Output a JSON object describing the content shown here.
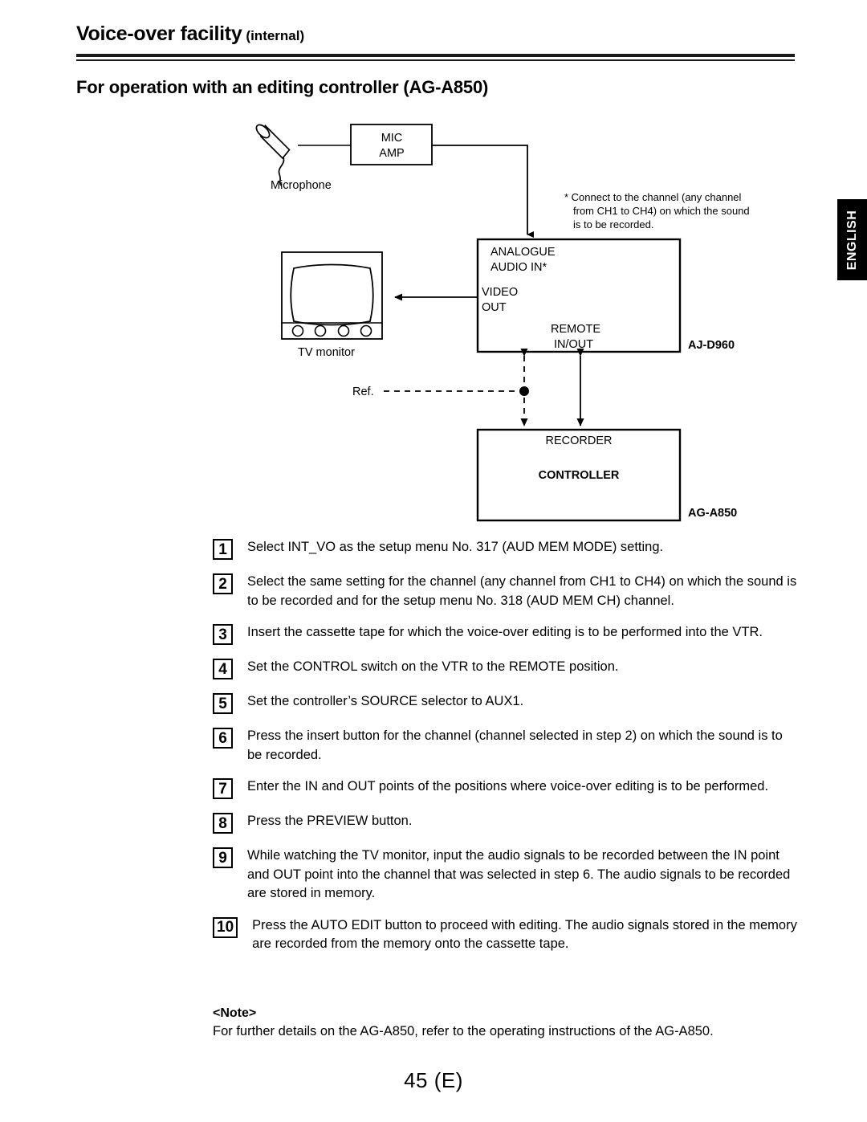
{
  "header": {
    "title": "Voice-over facility",
    "title_sub": "(internal)",
    "section_title": "For operation with an editing controller (AG-A850)"
  },
  "side_tab": {
    "label": "ENGLISH"
  },
  "diagram": {
    "mic_label": "Microphone",
    "mic_amp_line1": "MIC",
    "mic_amp_line2": "AMP",
    "footnote_line1": "* Connect to the channel (any channel",
    "footnote_line2": "from CH1 to CH4) on which the sound",
    "footnote_line3": "is to be recorded.",
    "analogue_line1": "ANALOGUE",
    "analogue_line2": "AUDIO IN*",
    "video_line1": "VIDEO",
    "video_line2": "OUT",
    "remote_line1": "REMOTE",
    "remote_line2": "IN/OUT",
    "vtr_model": "AJ-D960",
    "tv_label": "TV monitor",
    "ref_label": "Ref.",
    "recorder_label": "RECORDER",
    "controller_label": "CONTROLLER",
    "controller_model": "AG-A850"
  },
  "steps": [
    {
      "num": "1",
      "text": "Select INT_VO as the setup menu No. 317 (AUD MEM MODE) setting.",
      "justify": false
    },
    {
      "num": "2",
      "text": "Select the same setting for the channel (any channel from CH1 to CH4) on which the sound is to be recorded and for the setup menu No. 318 (AUD MEM CH) channel.",
      "justify": false
    },
    {
      "num": "3",
      "text": "Insert the cassette tape for which the voice-over editing is to be performed into the VTR.",
      "justify": true
    },
    {
      "num": "4",
      "text": "Set the CONTROL switch on the VTR to the REMOTE position.",
      "justify": false
    },
    {
      "num": "5",
      "text": "Set the controller’s SOURCE selector to AUX1.",
      "justify": false
    },
    {
      "num": "6",
      "text": "Press the insert button for the channel (channel selected in step 2) on which the sound is to be recorded.",
      "justify": false
    },
    {
      "num": "7",
      "text": "Enter the IN and OUT points of the positions where voice-over editing is to be performed.",
      "justify": true
    },
    {
      "num": "8",
      "text": "Press the PREVIEW button.",
      "justify": false
    },
    {
      "num": "9",
      "text": "While watching the TV monitor, input the audio signals to be recorded between the IN point and OUT point into the channel that was selected in step 6. The audio signals to be recorded are stored in memory.",
      "justify": false
    },
    {
      "num": "10",
      "text": "Press the AUTO EDIT button to proceed with editing. The audio signals stored in the memory are recorded from the memory onto the cassette tape.",
      "justify": false
    }
  ],
  "note": {
    "title": "<Note>",
    "text": "For further details on the AG-A850, refer to the operating instructions of the AG-A850."
  },
  "footer": {
    "page_number": "45 (E)"
  },
  "colors": {
    "ink": "#000000",
    "tab_background": "#000000",
    "tab_text": "#ffffff"
  }
}
